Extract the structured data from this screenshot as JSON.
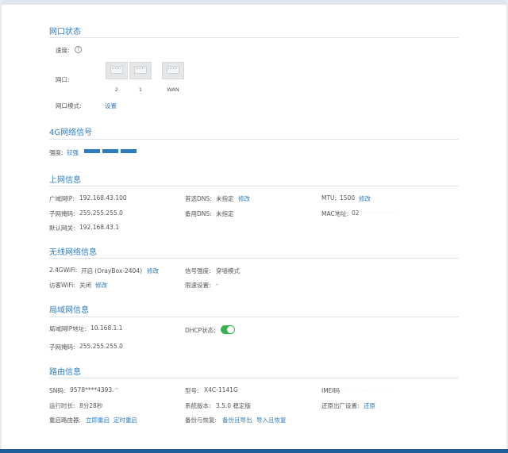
{
  "port_status": {
    "title": "网口状态",
    "speed_label": "速度:",
    "help_icon": "?",
    "port_label": "网口:",
    "ports": [
      {
        "name": "2"
      },
      {
        "name": "1"
      },
      {
        "name": "WAN"
      }
    ],
    "mode_label": "网口模式:",
    "mode_link": "设置"
  },
  "signal": {
    "title": "4G网络信号",
    "strength_label": "强度:",
    "strength_value": "较强",
    "bars": 3,
    "bar_color": "#2d7cc1"
  },
  "internet": {
    "title": "上网信息",
    "wan_ip_label": "广域网IP:",
    "wan_ip": "192.168.43.100",
    "dns1_label": "首选DNS:",
    "dns1_value": "未指定",
    "dns1_link": "修改",
    "mtu_label": "MTU:",
    "mtu_value": "1500",
    "mtu_link": "修改",
    "mask_label": "子网掩码:",
    "mask_value": "255.255.255.0",
    "dns2_label": "备用DNS:",
    "dns2_value": "未指定",
    "mac_label": "MAC地址:",
    "mac_value": "02",
    "gateway_label": "默认网关:",
    "gateway_value": "192.168.43.1"
  },
  "wireless": {
    "title": "无线网络信息",
    "wifi_label": "2.4GWiFi:",
    "wifi_value": "开启 (OrayBox-2404)",
    "wifi_link": "修改",
    "signal_label": "信号强度:",
    "signal_value": "穿墙模式",
    "guest_label": "访客WiFi:",
    "guest_value": "关闭",
    "guest_link": "修改",
    "limit_label": "限速设置:",
    "limit_value": "-"
  },
  "lan": {
    "title": "局域网信息",
    "lan_ip_label": "局域网IP地址:",
    "lan_ip_value": "10.168.1.1",
    "dhcp_label": "DHCP状态:",
    "dhcp_on": true,
    "dhcp_color": "#33b34a",
    "mask_label": "子网掩码:",
    "mask_value": "255.255.255.0"
  },
  "router": {
    "title": "路由信息",
    "sn_label": "SN码:",
    "sn_value": "9578****4393",
    "model_label": "型号:",
    "model_value": "X4C-1141G",
    "imei_label": "IMEI码",
    "uptime_label": "运行时长:",
    "uptime_value": "8分28秒",
    "version_label": "系统版本:",
    "version_value": "3.5.0 稳定版",
    "restore_label": "还原出厂设置:",
    "restore_link": "还原",
    "reboot_label": "重启路由器:",
    "reboot_now": "立即重启",
    "reboot_timed": "定时重启",
    "backup_label": "备份与恢复:",
    "backup_export": "备份且导出",
    "backup_import": "导入且恢复"
  },
  "colors": {
    "accent": "#2d7cc1",
    "bottom_bar": "#1f5f99"
  }
}
